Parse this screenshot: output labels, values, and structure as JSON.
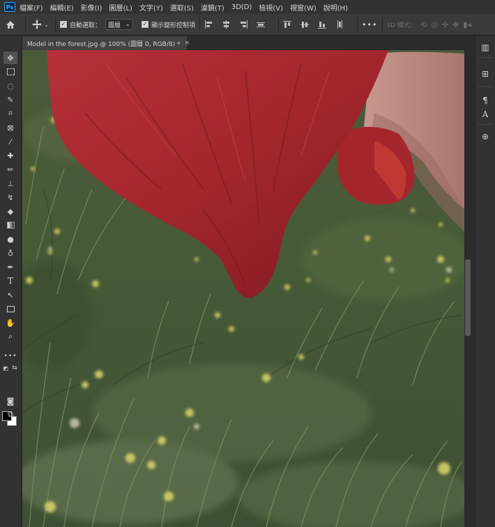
{
  "app": {
    "logo_text": "Ps",
    "menu": [
      "檔案(F)",
      "編輯(E)",
      "影像(I)",
      "圖層(L)",
      "文字(Y)",
      "選取(S)",
      "濾鏡(T)",
      "3D(D)",
      "檢視(V)",
      "視窗(W)",
      "說明(H)"
    ]
  },
  "options_bar": {
    "home_icon": "home-icon",
    "move_icon": "move-tool-icon",
    "auto_select_label": "自動選取：",
    "auto_select_checked": true,
    "auto_select_target": "圖層",
    "show_transform_label": "顯示變形控制項",
    "show_transform_checked": true,
    "more_label": "•••",
    "mode_3d_label": "3D 模式："
  },
  "document": {
    "tab_title": "Model in the forest.jpg @ 100% (圖層 0, RGB/8) *",
    "close_label": "×"
  },
  "tools": [
    "move-tool",
    "marquee-tool",
    "lasso-tool",
    "quick-select-tool",
    "crop-tool",
    "frame-tool",
    "eyedropper-tool",
    "healing-brush-tool",
    "brush-tool",
    "clone-stamp-tool",
    "history-brush-tool",
    "eraser-tool",
    "gradient-tool",
    "blur-tool",
    "dodge-tool",
    "pen-tool",
    "type-tool",
    "path-select-tool",
    "rectangle-tool",
    "hand-tool",
    "zoom-tool"
  ],
  "tool_labels": {
    "type_tool": "T",
    "more_tools": "•••"
  },
  "colors": {
    "foreground": "#000000",
    "background": "#ffffff",
    "accent": "#31a8ff",
    "dress": "#a8282c",
    "grass": "#4a5e38"
  }
}
